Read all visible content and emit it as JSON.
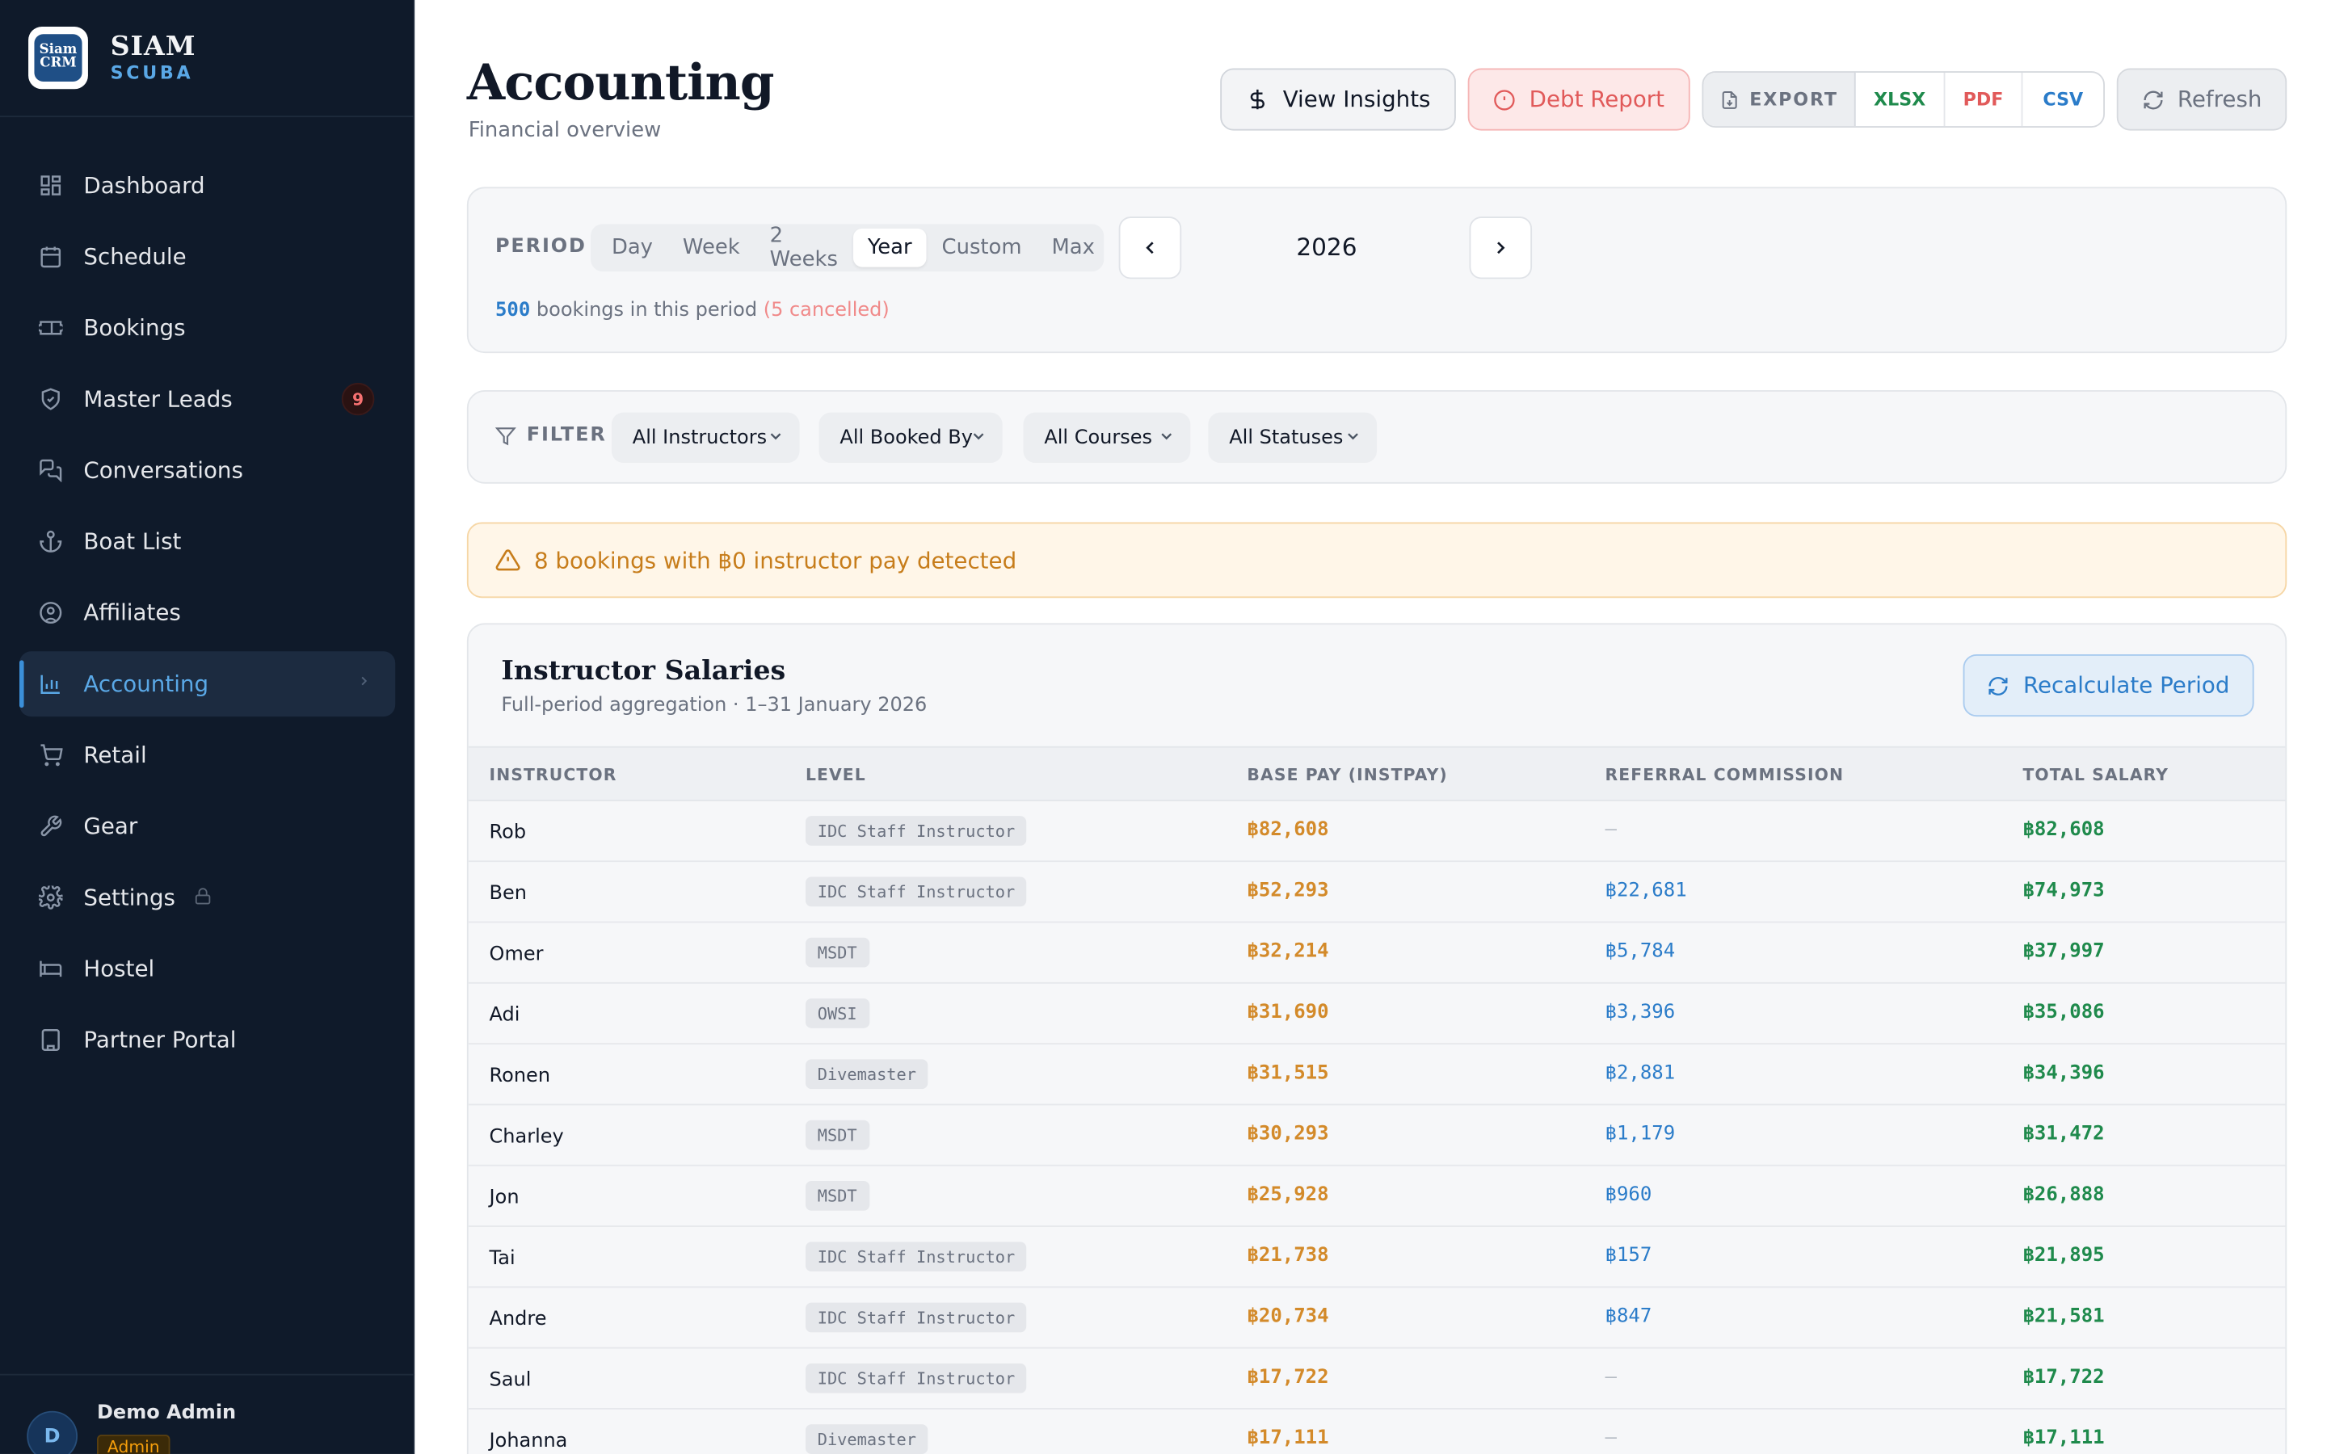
{
  "brand": {
    "name": "SIAM",
    "sub": "SCUBA",
    "logo_text": "Siam CRM"
  },
  "nav": [
    {
      "label": "Dashboard",
      "icon": "dashboard-icon"
    },
    {
      "label": "Schedule",
      "icon": "calendar-icon"
    },
    {
      "label": "Bookings",
      "icon": "ticket-icon"
    },
    {
      "label": "Master Leads",
      "icon": "shield-icon",
      "badge": "9"
    },
    {
      "label": "Conversations",
      "icon": "chat-icon"
    },
    {
      "label": "Boat List",
      "icon": "anchor-icon"
    },
    {
      "label": "Affiliates",
      "icon": "user-circle-icon"
    },
    {
      "label": "Accounting",
      "icon": "bar-chart-icon",
      "active": true
    },
    {
      "label": "Retail",
      "icon": "cart-icon"
    },
    {
      "label": "Gear",
      "icon": "wrench-icon"
    },
    {
      "label": "Settings",
      "icon": "gear-icon",
      "locked": true
    },
    {
      "label": "Hostel",
      "icon": "bed-icon"
    },
    {
      "label": "Partner Portal",
      "icon": "building-icon"
    }
  ],
  "user": {
    "initial": "D",
    "name": "Demo Admin",
    "role": "Admin"
  },
  "header": {
    "title": "Accounting",
    "subtitle": "Financial overview",
    "insights_label": "View Insights",
    "debt_label": "Debt Report",
    "export_label": "EXPORT",
    "export_options": [
      {
        "label": "XLSX",
        "color": "#1f8a4c"
      },
      {
        "label": "PDF",
        "color": "#e15a5a"
      },
      {
        "label": "CSV",
        "color": "#2b7cc9"
      }
    ],
    "refresh_label": "Refresh"
  },
  "period": {
    "label": "PERIOD",
    "options": [
      "Day",
      "Week",
      "2 Weeks",
      "Year",
      "Custom",
      "Max"
    ],
    "selected": "Year",
    "value": "2026",
    "count": "500",
    "count_text": " bookings in this period ",
    "cancelled": "(5 cancelled)"
  },
  "filter": {
    "label": "FILTER",
    "selects": [
      "All Instructors",
      "All Booked By",
      "All Courses",
      "All Statuses"
    ]
  },
  "warning": {
    "text": "8 bookings with ฿0 instructor pay detected"
  },
  "salaries": {
    "title": "Instructor Salaries",
    "subtitle": "Full-period aggregation · 1–31 January 2026",
    "recalc_label": "Recalculate Period",
    "columns": [
      "INSTRUCTOR",
      "LEVEL",
      "BASE PAY (INSTPAY)",
      "REFERRAL COMMISSION",
      "TOTAL SALARY"
    ],
    "rows": [
      {
        "name": "Rob",
        "level": "IDC Staff Instructor",
        "base": "฿82,608",
        "ref": "—",
        "total": "฿82,608"
      },
      {
        "name": "Ben",
        "level": "IDC Staff Instructor",
        "base": "฿52,293",
        "ref": "฿22,681",
        "total": "฿74,973"
      },
      {
        "name": "Omer",
        "level": "MSDT",
        "base": "฿32,214",
        "ref": "฿5,784",
        "total": "฿37,997"
      },
      {
        "name": "Adi",
        "level": "OWSI",
        "base": "฿31,690",
        "ref": "฿3,396",
        "total": "฿35,086"
      },
      {
        "name": "Ronen",
        "level": "Divemaster",
        "base": "฿31,515",
        "ref": "฿2,881",
        "total": "฿34,396"
      },
      {
        "name": "Charley",
        "level": "MSDT",
        "base": "฿30,293",
        "ref": "฿1,179",
        "total": "฿31,472"
      },
      {
        "name": "Jon",
        "level": "MSDT",
        "base": "฿25,928",
        "ref": "฿960",
        "total": "฿26,888"
      },
      {
        "name": "Tai",
        "level": "IDC Staff Instructor",
        "base": "฿21,738",
        "ref": "฿157",
        "total": "฿21,895"
      },
      {
        "name": "Andre",
        "level": "IDC Staff Instructor",
        "base": "฿20,734",
        "ref": "฿847",
        "total": "฿21,581"
      },
      {
        "name": "Saul",
        "level": "IDC Staff Instructor",
        "base": "฿17,722",
        "ref": "—",
        "total": "฿17,722"
      },
      {
        "name": "Johanna",
        "level": "Divemaster",
        "base": "฿17,111",
        "ref": "—",
        "total": "฿17,111"
      }
    ]
  }
}
